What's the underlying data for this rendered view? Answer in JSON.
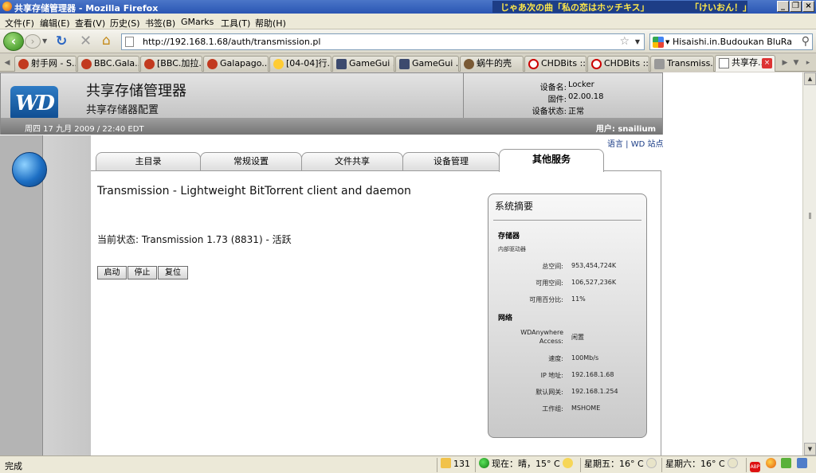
{
  "window": {
    "title": "共享存储管理器 - Mozilla Firefox",
    "marquee_left": "じゃあ次の曲「私の恋はホッチキス」",
    "marquee_right": "「けいおん！」"
  },
  "menu": [
    "文件(F)",
    "编辑(E)",
    "查看(V)",
    "历史(S)",
    "书签(B)",
    "GMarks",
    "工具(T)",
    "帮助(H)"
  ],
  "nav": {
    "url": "http://192.168.1.68/auth/transmission.pl",
    "search_value": "Hisaishi.in.Budoukan BluRay"
  },
  "tabs": [
    {
      "label": "射手网 - S...",
      "icon": "rd"
    },
    {
      "label": "BBC.Gala...",
      "icon": "rd"
    },
    {
      "label": "[BBC.加拉...",
      "icon": "rd"
    },
    {
      "label": "Galapago...",
      "icon": "rd"
    },
    {
      "label": "[04-04]行...",
      "icon": "sun"
    },
    {
      "label": "GameGui ...",
      "icon": "gg"
    },
    {
      "label": "GameGui ...",
      "icon": "gg"
    },
    {
      "label": "蜗牛的壳",
      "icon": "snail"
    },
    {
      "label": "CHDBits ::...",
      "icon": "chd"
    },
    {
      "label": "CHDBits ::...",
      "icon": "chd"
    },
    {
      "label": "Transmiss...",
      "icon": "tr"
    },
    {
      "label": "共享存...",
      "icon": "doc",
      "active": true
    }
  ],
  "header": {
    "logo": "WD",
    "title": "共享存储管理器",
    "subtitle": "共享存储器配置",
    "device_name_label": "设备名:",
    "device_name": "Locker",
    "firmware_label": "固件:",
    "firmware": "02.00.18",
    "device_status_label": "设备状态:",
    "device_status": "正常",
    "date": "周四 17 九月 2009 / 22:40 EDT",
    "user": "用户: snailium"
  },
  "links": "语言 | WD 站点",
  "main_tabs": [
    "主目录",
    "常规设置",
    "文件共享",
    "设备管理",
    "其他服务"
  ],
  "service": {
    "title": "Transmission - Lightweight BitTorrent client and daemon",
    "status": "当前状态: Transmission 1.73 (8831) - 活跃",
    "btn_start": "启动",
    "btn_stop": "停止",
    "btn_reset": "复位"
  },
  "summary": {
    "title": "系统摘要",
    "storage_heading": "存储器",
    "storage_sub": "内部驱动器",
    "total_label": "总空间:",
    "total": "953,454,724K",
    "avail_label": "可用空间:",
    "avail": "106,527,236K",
    "pct_label": "可用百分比:",
    "pct": "11%",
    "network_heading": "网络",
    "wda_label1": "WDAnywhere",
    "wda_label2": "Access:",
    "wda": "闲置",
    "speed_label": "速度:",
    "speed": "100Mb/s",
    "ip_label": "IP 地址:",
    "ip": "192.168.1.68",
    "gw_label": "默认网关:",
    "gw": "192.168.1.254",
    "wg_label": "工作组:",
    "wg": "MSHOME"
  },
  "status": {
    "done": "完成",
    "tabs_count": "131",
    "weather_now": "现在：晴，15° C",
    "weather_fri": "星期五：16° C",
    "weather_sat": "星期六：16° C"
  }
}
